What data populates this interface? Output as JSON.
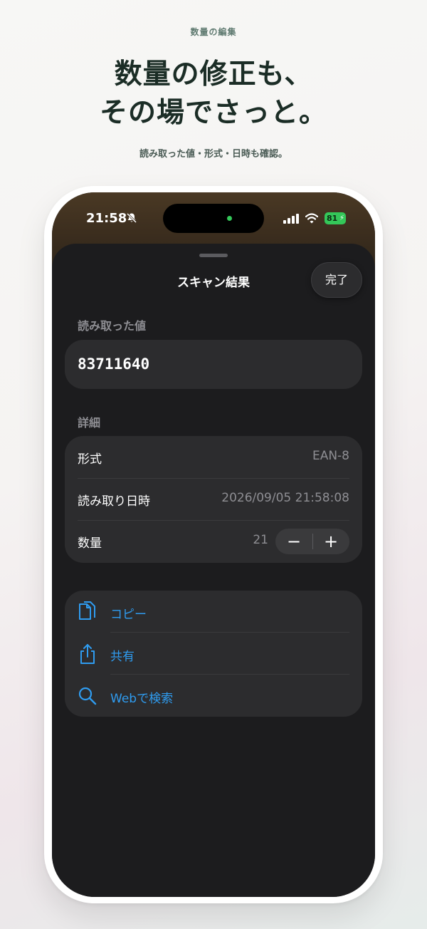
{
  "promo": {
    "eyebrow": "数量の編集",
    "headline_line1": "数量の修正も、",
    "headline_line2": "その場でさっと。",
    "subhead": "読み取った値・形式・日時も確認。"
  },
  "status_bar": {
    "time": "21:58",
    "battery": "81"
  },
  "sheet": {
    "title": "スキャン結果",
    "done_label": "完了",
    "value_section_label": "読み取った値",
    "scanned_value": "83711640",
    "details_section_label": "詳細",
    "details": [
      {
        "label": "形式",
        "value": "EAN-8"
      },
      {
        "label": "読み取り日時",
        "value": "2026/09/05 21:58:08"
      }
    ],
    "quantity": {
      "label": "数量",
      "value": "21",
      "decrement": "−",
      "increment": "+"
    },
    "actions": [
      {
        "label": "コピー",
        "icon": "copy-icon"
      },
      {
        "label": "共有",
        "icon": "share-icon"
      },
      {
        "label": "Webで検索",
        "icon": "search-icon"
      }
    ]
  },
  "colors": {
    "accent": "#2f9cf0",
    "sheet_bg": "#1c1c1e",
    "card_bg": "#2c2c2e",
    "battery": "#34c759"
  }
}
